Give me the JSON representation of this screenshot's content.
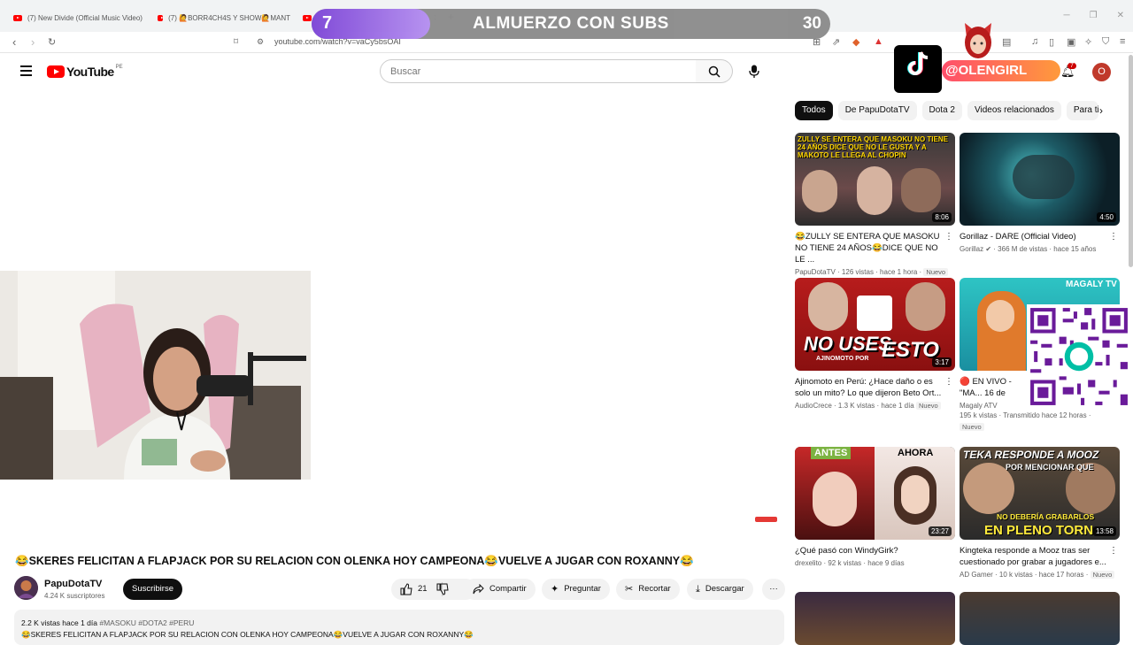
{
  "browser": {
    "tabs": [
      {
        "label": "(7) New Divide (Official Music Video)"
      },
      {
        "label": "(7) 🙋BORR4CH4S Y SHOW🙋MANT"
      },
      {
        "label": ""
      }
    ],
    "url": "youtube.com/watch?v=vaCy5bsOAI"
  },
  "overlay_banner": {
    "left_number": "7",
    "title": "ALMUERZO CON SUBS",
    "right_number": "30"
  },
  "tiktok": {
    "label": "TikTok",
    "handle": "@OLENGIRL"
  },
  "header": {
    "logo_text": "YouTube",
    "country": "PE",
    "search_placeholder": "Buscar",
    "notif_count": "7",
    "avatar_letter": "O"
  },
  "chips": [
    "Todos",
    "De PapuDotaTV",
    "Dota 2",
    "Videos relacionados",
    "Para ti"
  ],
  "sidebar_videos": [
    {
      "title": "😂ZULLY SE ENTERA QUE MASOKU NO TIENE 24 AÑOS😂DICE QUE NO LE ...",
      "channel": "PapuDotaTV",
      "meta": "126 vistas · hace 1 hora",
      "badge": "Nuevo",
      "duration": "8:06",
      "thumb_text": "ZULLY SE ENTERA QUE MASOKU NO TIENE 24 AÑOS DICE QUE NO LE GUSTA Y A MAKOTO LE LLEGA AL CHOPIN"
    },
    {
      "title": "Gorillaz - DARE (Official Video)",
      "channel": "Gorillaz",
      "meta": "366 M de vistas · hace 15 años",
      "badge": "",
      "duration": "4:50",
      "thumb_text": ""
    },
    {
      "title": "Ajinomoto en Perú: ¿Hace daño o es solo un mito? Lo que dijeron Beto Ort...",
      "channel": "AudioCrece",
      "meta": "1.3 K vistas · hace 1 día",
      "badge": "Nuevo",
      "duration": "3:17",
      "thumb_text_1": "NO USES",
      "thumb_text_2": "AJINOMOTO POR",
      "thumb_text_3": "ESTO"
    },
    {
      "title": "🔴 EN VIVO - \"MA... 16 de FEBRERO d...",
      "channel": "Magaly ATV",
      "meta": "195 k vistas · Transmitido hace 12 horas ·",
      "badge": "Nuevo",
      "duration": "",
      "thumb_text": "MAGALY TV"
    },
    {
      "title": "¿Qué pasó con WindyGirk?",
      "channel": "drexelito",
      "meta": "92 k vistas · hace 9 días",
      "badge": "",
      "duration": "23:27",
      "thumb_text_1": "ANTES",
      "thumb_text_2": "AHORA"
    },
    {
      "title": "Kingteka responde a Mooz tras ser cuestionado por grabar a jugadores e...",
      "channel": "AD Gamer",
      "meta": "10 k vistas · hace 17 horas ·",
      "badge": "Nuevo",
      "duration": "13:58",
      "thumb_text_1": "TEKA RESPONDE A MOOZ",
      "thumb_text_2": "POR MENCIONAR QUE",
      "thumb_text_3": "NO DEBERÍA GRABARLOS",
      "thumb_text_4": "EN PLENO TORN"
    }
  ],
  "video": {
    "title": "😂SKERES FELICITAN A FLAPJACK POR SU RELACION CON OLENKA HOY CAMPEONA😂VUELVE A JUGAR CON ROXANNY😂",
    "channel": "PapuDotaTV",
    "subscribers": "4.24 K suscriptores",
    "subscribe_label": "Suscribirse",
    "likes": "21",
    "share_label": "Compartir",
    "ask_label": "Preguntar",
    "clip_label": "Recortar",
    "download_label": "Descargar",
    "more_label": "···",
    "views_line": "2.2 K vistas  hace 1 día",
    "tags": "#MASOKU #DOTA2 #PERU",
    "desc_line": "😂SKERES FELICITAN A FLAPJACK POR SU RELACION CON OLENKA HOY CAMPEONA😂VUELVE A JUGAR CON ROXANNY😂"
  },
  "colors": {
    "yt_red": "#ff0000",
    "banner_purple": "#7b42d6",
    "tiktok_gradient_start": "#ff4e6b"
  }
}
